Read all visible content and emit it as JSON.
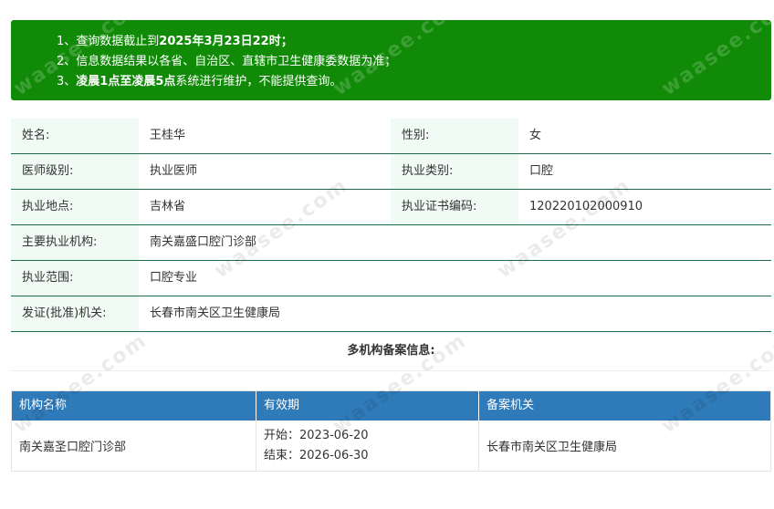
{
  "notice": {
    "line1_prefix": "1、查询数据截止到",
    "line1_bold": "2025年3月23日22时；",
    "line2": "2、信息数据结果以各省、自治区、直辖市卫生健康委数据为准；",
    "line3_prefix": "3、",
    "line3_bold": "凌晨1点至凌晨5点",
    "line3_suffix": "系统进行维护，不能提供查询。",
    "bg_color": "#118a08"
  },
  "info": {
    "name_label": "姓名:",
    "name_value": "王桂华",
    "gender_label": "性别:",
    "gender_value": "女",
    "level_label": "医师级别:",
    "level_value": "执业医师",
    "category_label": "执业类别:",
    "category_value": "口腔",
    "location_label": "执业地点:",
    "location_value": "吉林省",
    "cert_label": "执业证书编码:",
    "cert_value": "120220102000910",
    "institution_label": "主要执业机构:",
    "institution_value": "南关嘉盛口腔门诊部",
    "scope_label": "执业范围:",
    "scope_value": "口腔专业",
    "issuer_label": "发证(批准)机关:",
    "issuer_value": "长春市南关区卫生健康局"
  },
  "multi": {
    "title": "多机构备案信息:",
    "headers": [
      "机构名称",
      "有效期",
      "备案机关"
    ],
    "rows": [
      {
        "name": "南关嘉圣口腔门诊部",
        "start": "开始：2023-06-20",
        "end": "结束：2026-06-30",
        "authority": "长春市南关区卫生健康局"
      }
    ],
    "header_color": "#2f7ab8"
  },
  "watermark": "waasee.com"
}
